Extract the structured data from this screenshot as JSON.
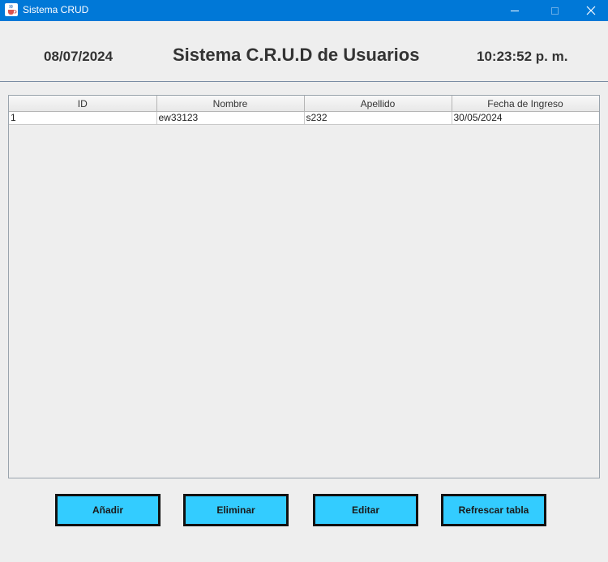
{
  "window": {
    "title": "Sistema CRUD",
    "icon": "java-cup-icon",
    "controls": [
      "minimize-icon",
      "maximize-icon",
      "close-icon"
    ]
  },
  "header": {
    "date": "08/07/2024",
    "title": "Sistema C.R.U.D de Usuarios",
    "time": "10:23:52 p. m."
  },
  "table": {
    "columns": [
      "ID",
      "Nombre",
      "Apellido",
      "Fecha de Ingreso"
    ],
    "rows": [
      [
        "1",
        "ew33123",
        "s232",
        "30/05/2024"
      ]
    ]
  },
  "buttons": {
    "add": "Añadir",
    "delete": "Eliminar",
    "edit": "Editar",
    "refresh": "Refrescar tabla"
  },
  "colors": {
    "titlebar": "#0078d7",
    "button_fill": "#33ccff",
    "button_border": "#111111",
    "background": "#eeeeee"
  }
}
